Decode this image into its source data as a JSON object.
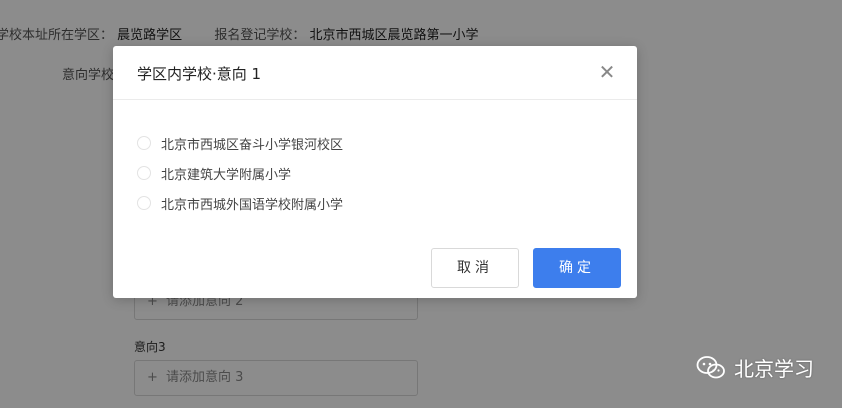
{
  "background": {
    "district_label": "学校本址所在学区：",
    "district_value": "晨览路学区",
    "school_label": "报名登记学校：",
    "school_value": "北京市西城区晨览路第一小学",
    "intent_label_partial": "意向学校",
    "field_label_3": "意向3",
    "add_intent_2": "请添加意向 2",
    "add_intent_3": "请添加意向 3"
  },
  "dialog": {
    "title": "学区内学校·意向 1",
    "close_glyph": "✕",
    "options": [
      {
        "label": "北京市西城区奋斗小学银河校区"
      },
      {
        "label": "北京建筑大学附属小学"
      },
      {
        "label": "北京市西城外国语学校附属小学"
      }
    ],
    "cancel_label": "取消",
    "confirm_label": "确定"
  },
  "watermark": {
    "text": "北京学习",
    "icon": "wechat-icon"
  },
  "colors": {
    "primary": "#3d7eed",
    "overlay": "rgba(0,0,0,0.45)"
  }
}
